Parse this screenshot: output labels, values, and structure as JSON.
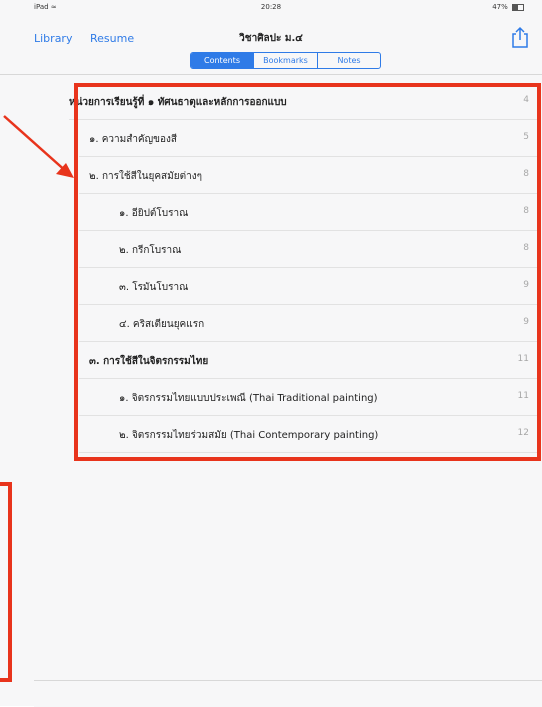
{
  "status_bar": {
    "left": "iPad ≈",
    "time": "20:28",
    "battery": "47%"
  },
  "nav": {
    "library": "Library",
    "resume": "Resume",
    "title": "วิชาศิลปะ ม.๔"
  },
  "tabs": [
    {
      "label": "Contents",
      "active": true
    },
    {
      "label": "Bookmarks",
      "active": false
    },
    {
      "label": "Notes",
      "active": false
    }
  ],
  "toc": [
    {
      "label": "หน่วยการเรียนรู้ที่ ๑ ทัศนธาตุและหลักการออกแบบ",
      "page": "4",
      "bold": true
    },
    {
      "label": "๑. ความสำคัญของสี",
      "page": "5",
      "bold": false
    },
    {
      "label": "๒. การใช้สีในยุคสมัยต่างๆ",
      "page": "8",
      "bold": false
    },
    {
      "label": "๑. อียิปต์โบราณ",
      "page": "8",
      "bold": false
    },
    {
      "label": "๒. กรีกโบราณ",
      "page": "8",
      "bold": false
    },
    {
      "label": "๓. โรมันโบราณ",
      "page": "9",
      "bold": false
    },
    {
      "label": "๔. คริสเตียนยุคแรก",
      "page": "9",
      "bold": false
    },
    {
      "label": "๓. การใช้สีในจิตรกรรมไทย",
      "page": "11",
      "bold": true
    },
    {
      "label": "๑. จิตรกรรมไทยแบบประเพณี (Thai Traditional painting)",
      "page": "11",
      "bold": false
    },
    {
      "label": "๒. จิตรกรรมไทยร่วมสมัย (Thai  Contemporary painting)",
      "page": "12",
      "bold": false
    }
  ],
  "accent_color": "#2f7be7",
  "annotation_color": "#e8341c"
}
